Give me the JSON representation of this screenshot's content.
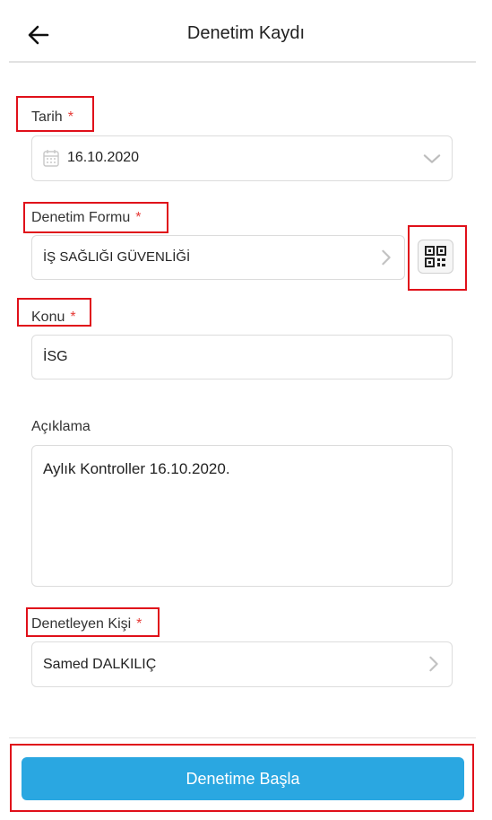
{
  "header": {
    "title": "Denetim Kaydı"
  },
  "form": {
    "date": {
      "label": "Tarih",
      "required": "*",
      "value": "16.10.2020"
    },
    "audit_form": {
      "label": "Denetim Formu",
      "required": "*",
      "value": "İŞ SAĞLIĞI GÜVENLİĞİ"
    },
    "subject": {
      "label": "Konu",
      "required": "*",
      "value": "İSG"
    },
    "description": {
      "label": "Açıklama",
      "value": "Aylık Kontroller 16.10.2020."
    },
    "auditor": {
      "label": "Denetleyen Kişi",
      "required": "*",
      "value": "Samed DALKILIÇ"
    }
  },
  "footer": {
    "start_label": "Denetime Başla"
  },
  "colors": {
    "accent": "#2aa7e1",
    "required": "#e53935",
    "highlight": "#e0101a"
  },
  "icons": [
    "back-arrow-icon",
    "calendar-icon",
    "chevron-down-icon",
    "chevron-right-icon",
    "qr-code-icon"
  ]
}
